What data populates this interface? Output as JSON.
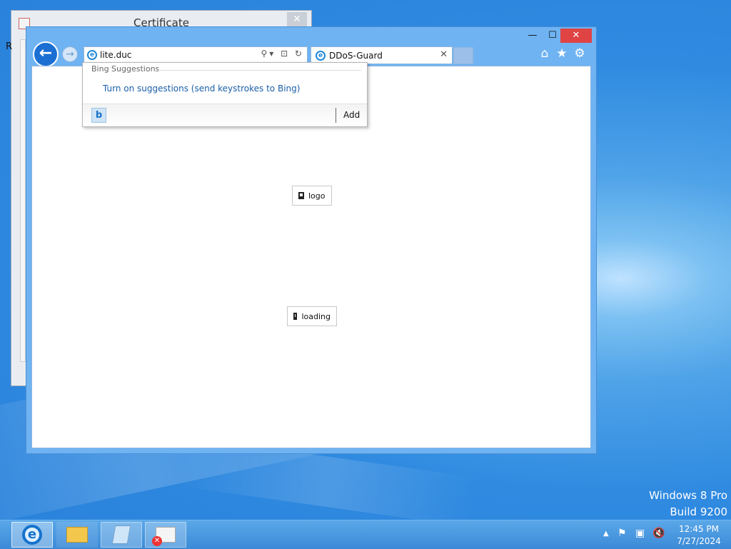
{
  "desktop": {
    "watermark_line1": "Windows 8 Pro",
    "watermark_line2": "Build 9200",
    "edge_letter": "R"
  },
  "cert_window": {
    "title": "Certificate",
    "close_glyph": "✕"
  },
  "ie": {
    "window_controls": {
      "minimize": "—",
      "maximize": "☐",
      "close": "✕"
    },
    "nav": {
      "back_glyph": "←",
      "forward_glyph": "→"
    },
    "address": {
      "value": "lite.duc",
      "icons": "⚲▾ ⊡ ↻"
    },
    "tab": {
      "label": "DDoS-Guard",
      "close_glyph": "✕"
    },
    "tools": {
      "home": "⌂",
      "favorites": "★",
      "settings": "⚙"
    },
    "page": {
      "logo_alt": "logo",
      "loading_alt": "loading"
    }
  },
  "suggestions": {
    "header": "Bing Suggestions",
    "link": "Turn on suggestions (send keystrokes to Bing)",
    "add_label": "Add",
    "provider_glyph": "b"
  },
  "taskbar": {
    "time": "12:45 PM",
    "date": "7/27/2024",
    "apps": [
      "Internet Explorer",
      "File Explorer",
      "PowerShell",
      "Certificate"
    ]
  },
  "colors": {
    "accent": "#1b6fd3",
    "window_frame": "#6fb3f2",
    "close_button": "#e04343",
    "link": "#1a5fa8"
  }
}
